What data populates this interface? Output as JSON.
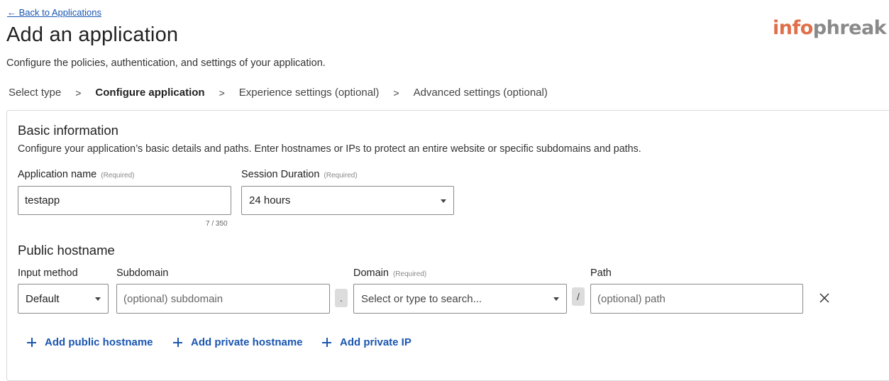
{
  "header": {
    "back_link": "← Back to Applications",
    "title": "Add an application",
    "description": "Configure the policies, authentication, and settings of your application.",
    "logo": {
      "part1": "info",
      "part2": "phreak"
    }
  },
  "steps": [
    {
      "label": "Select type",
      "active": false
    },
    {
      "label": "Configure application",
      "active": true
    },
    {
      "label": "Experience settings (optional)",
      "active": false
    },
    {
      "label": "Advanced settings (optional)",
      "active": false
    }
  ],
  "step_separator": ">",
  "basic_info": {
    "title": "Basic information",
    "description": "Configure your application’s basic details and paths. Enter hostnames or IPs to protect an entire website or specific subdomains and paths.",
    "app_name": {
      "label": "Application name",
      "required": "(Required)",
      "value": "testapp",
      "counter": "7 / 350"
    },
    "session_duration": {
      "label": "Session Duration",
      "required": "(Required)",
      "value": "24 hours"
    }
  },
  "public_hostname": {
    "title": "Public hostname",
    "input_method": {
      "label": "Input method",
      "value": "Default"
    },
    "subdomain": {
      "label": "Subdomain",
      "placeholder": "(optional) subdomain"
    },
    "dot": ".",
    "domain": {
      "label": "Domain",
      "required": "(Required)",
      "placeholder": "Select or type to search..."
    },
    "slash": "/",
    "path": {
      "label": "Path",
      "placeholder": "(optional) path"
    }
  },
  "actions": {
    "add_public": "Add public hostname",
    "add_private": "Add private hostname",
    "add_ip": "Add private IP"
  },
  "colors": {
    "link": "#1a56b0",
    "logo_accent": "#e0704a",
    "logo_gray": "#8a8a8a"
  }
}
